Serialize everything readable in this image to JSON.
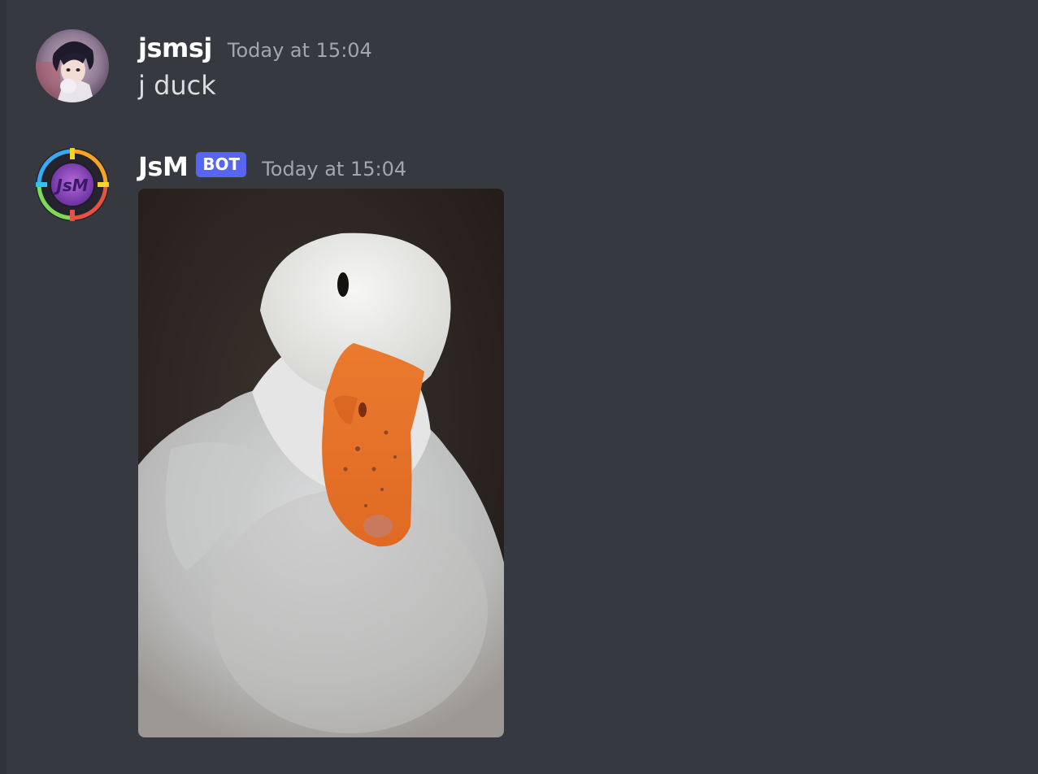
{
  "messages": [
    {
      "author": "jsmsj",
      "timestamp": "Today at 15:04",
      "content": "j duck",
      "avatar_icon": "user-avatar-anime"
    },
    {
      "author": "JsM",
      "badge": "BOT",
      "timestamp": "Today at 15:04",
      "avatar_icon": "jsm-logo-avatar",
      "avatar_text": "JsM",
      "attachment": {
        "type": "image",
        "subject": "white duck with orange bill"
      }
    }
  ],
  "colors": {
    "background": "#36393f",
    "bot_badge": "#5865f2",
    "username": "#ffffff",
    "timestamp": "#a3a6aa",
    "message_text": "#dcddde"
  }
}
